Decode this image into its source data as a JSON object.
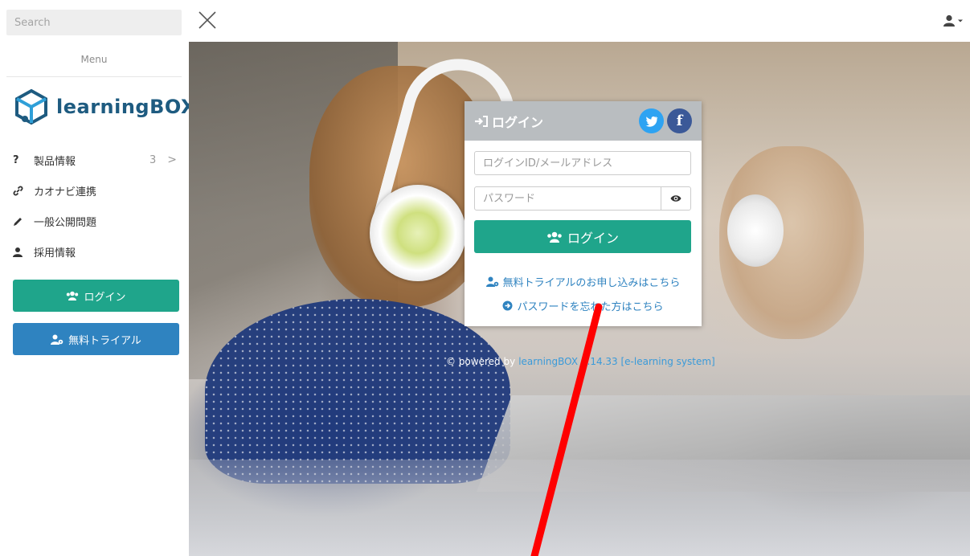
{
  "search": {
    "placeholder": "Search"
  },
  "sidebar": {
    "menu_title": "Menu",
    "logo_text": "learningBOX",
    "items": [
      {
        "icon": "question-icon",
        "label": "製品情報",
        "count": "3",
        "chevron": ">"
      },
      {
        "icon": "link-icon",
        "label": "カオナビ連携"
      },
      {
        "icon": "pencil-icon",
        "label": "一般公開問題"
      },
      {
        "icon": "user-icon",
        "label": "採用情報"
      }
    ],
    "login_button": "ログイン",
    "trial_button": "無料トライアル"
  },
  "login_panel": {
    "title": "ログイン",
    "id_placeholder": "ログインID/メールアドレス",
    "password_placeholder": "パスワード",
    "submit_label": "ログイン",
    "trial_link": "無料トライアルのお申し込みはこちら",
    "forgot_link": "パスワードを忘れた方はこちら"
  },
  "footer": {
    "powered_prefix": "© powered by",
    "powered_link": "learningBOX 4.14.33 [e-learning system]"
  },
  "colors": {
    "accent_green": "#1fa58b",
    "accent_blue": "#2f83c0",
    "logo_blue": "#1e5b80",
    "panel_header": "#b9bdc0",
    "twitter": "#2ea3f2",
    "facebook": "#3b5998",
    "annotation": "#ff0000"
  }
}
